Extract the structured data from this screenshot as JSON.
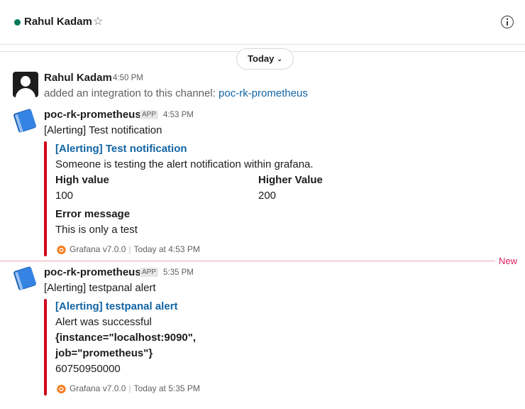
{
  "header": {
    "channel_name": "Rahul Kadam",
    "star_icon": "☆",
    "status_color": "#007a5a"
  },
  "divider": {
    "day_label": "Today"
  },
  "messages": [
    {
      "sender": "Rahul Kadam",
      "time": "4:50 PM",
      "text_prefix": "added an integration to this channel: ",
      "link": "poc-rk-prometheus"
    },
    {
      "sender": "poc-rk-prometheus",
      "badge": "APP",
      "time": "4:53 PM",
      "text": "[Alerting] Test notification",
      "attachment": {
        "title": "[Alerting] Test notification",
        "body": "Someone is testing the alert notification within grafana.",
        "fields": [
          {
            "title": "High value",
            "value": "100"
          },
          {
            "title": "Higher Value",
            "value": "200"
          },
          {
            "title": "Error message",
            "value": "This is only a test"
          }
        ],
        "footer_source": "Grafana v7.0.0",
        "footer_time": "Today at 4:53 PM",
        "color": "#d0021b"
      }
    },
    {
      "sender": "poc-rk-prometheus",
      "badge": "APP",
      "time": "5:35 PM",
      "text": "[Alerting] testpanal alert",
      "attachment": {
        "title": "[Alerting] testpanal alert",
        "body": "Alert was successful",
        "metric_line1": "{instance=\"localhost:9090\",",
        "metric_line2": "job=\"prometheus\"}",
        "metric_value": "60750950000",
        "footer_source": "Grafana v7.0.0",
        "footer_time": "Today at 5:35 PM",
        "color": "#d0021b"
      }
    }
  ],
  "new_marker": "New",
  "icons": {
    "info": "info-icon",
    "app_avatar": "notebook-icon",
    "grafana": "grafana-icon"
  }
}
